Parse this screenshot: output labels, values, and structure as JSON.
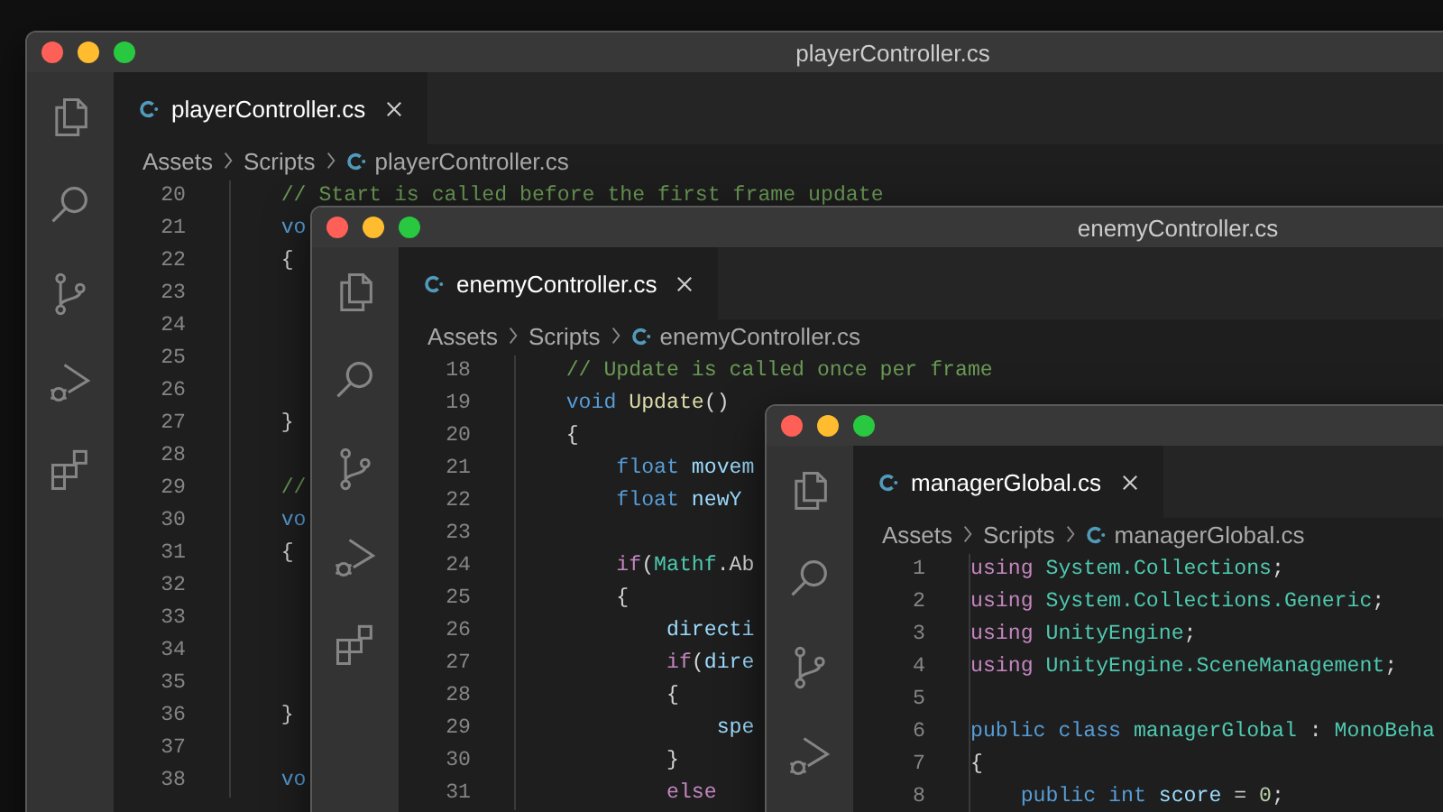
{
  "windows": [
    {
      "title": "playerController.cs",
      "tab": {
        "label": "playerController.cs",
        "selected": true
      },
      "breadcrumb": [
        "Assets",
        "Scripts",
        "playerController.cs"
      ],
      "lines": [
        {
          "number": "20",
          "segments": [
            {
              "kind": "comment",
              "text": "    // Start is called before the first frame update"
            }
          ]
        },
        {
          "number": "21",
          "segments": [
            {
              "kind": "keyword",
              "text": "    vo"
            }
          ]
        },
        {
          "number": "22",
          "segments": [
            {
              "kind": "plain",
              "text": "    {"
            }
          ]
        },
        {
          "number": "23"
        },
        {
          "number": "24"
        },
        {
          "number": "25"
        },
        {
          "number": "26"
        },
        {
          "number": "27",
          "segments": [
            {
              "kind": "plain",
              "text": "    }"
            }
          ]
        },
        {
          "number": "28"
        },
        {
          "number": "29",
          "segments": [
            {
              "kind": "comment",
              "text": "    //"
            }
          ]
        },
        {
          "number": "30",
          "segments": [
            {
              "kind": "keyword",
              "text": "    vo"
            }
          ]
        },
        {
          "number": "31",
          "segments": [
            {
              "kind": "plain",
              "text": "    {"
            }
          ]
        },
        {
          "number": "32"
        },
        {
          "number": "33"
        },
        {
          "number": "34"
        },
        {
          "number": "35"
        },
        {
          "number": "36",
          "segments": [
            {
              "kind": "plain",
              "text": "    }"
            }
          ]
        },
        {
          "number": "37"
        },
        {
          "number": "38",
          "segments": [
            {
              "kind": "keyword",
              "text": "    vo"
            }
          ]
        }
      ]
    },
    {
      "title": "enemyController.cs",
      "tab": {
        "label": "enemyController.cs",
        "selected": true
      },
      "breadcrumb": [
        "Assets",
        "Scripts",
        "enemyController.cs"
      ],
      "lines": [
        {
          "number": "18",
          "segments": [
            {
              "kind": "comment",
              "text": "    // Update is called once per frame"
            }
          ]
        },
        {
          "number": "19",
          "segments": [
            {
              "kind": "keyword",
              "text": "    void"
            },
            {
              "kind": "function",
              "text": " Update"
            },
            {
              "kind": "plain",
              "text": "()"
            }
          ]
        },
        {
          "number": "20",
          "segments": [
            {
              "kind": "plain",
              "text": "    {"
            }
          ]
        },
        {
          "number": "21",
          "segments": [
            {
              "kind": "keyword",
              "text": "        float"
            },
            {
              "kind": "variable",
              "text": " movem"
            }
          ]
        },
        {
          "number": "22",
          "segments": [
            {
              "kind": "keyword",
              "text": "        float"
            },
            {
              "kind": "variable",
              "text": " newY"
            }
          ]
        },
        {
          "number": "23"
        },
        {
          "number": "24",
          "segments": [
            {
              "kind": "control",
              "text": "        if"
            },
            {
              "kind": "plain",
              "text": "("
            },
            {
              "kind": "type",
              "text": "Mathf"
            },
            {
              "kind": "plain",
              "text": ".Ab"
            }
          ]
        },
        {
          "number": "25",
          "segments": [
            {
              "kind": "plain",
              "text": "        {"
            }
          ]
        },
        {
          "number": "26",
          "segments": [
            {
              "kind": "variable",
              "text": "            directi"
            }
          ]
        },
        {
          "number": "27",
          "segments": [
            {
              "kind": "control",
              "text": "            if"
            },
            {
              "kind": "plain",
              "text": "("
            },
            {
              "kind": "variable",
              "text": "dire"
            }
          ]
        },
        {
          "number": "28",
          "segments": [
            {
              "kind": "plain",
              "text": "            {"
            }
          ]
        },
        {
          "number": "29",
          "segments": [
            {
              "kind": "variable",
              "text": "                spe"
            }
          ]
        },
        {
          "number": "30",
          "segments": [
            {
              "kind": "plain",
              "text": "            }"
            }
          ]
        },
        {
          "number": "31",
          "segments": [
            {
              "kind": "control",
              "text": "            else"
            }
          ]
        }
      ]
    },
    {
      "tab": {
        "label": "managerGlobal.cs",
        "selected": true
      },
      "breadcrumb": [
        "Assets",
        "Scripts",
        "managerGlobal.cs"
      ],
      "lines": [
        {
          "number": "1",
          "segments": [
            {
              "kind": "control",
              "text": "using"
            },
            {
              "kind": "type",
              "text": " System.Collections"
            },
            {
              "kind": "plain",
              "text": ";"
            }
          ]
        },
        {
          "number": "2",
          "segments": [
            {
              "kind": "control",
              "text": "using"
            },
            {
              "kind": "type",
              "text": " System.Collections.Generic"
            },
            {
              "kind": "plain",
              "text": ";"
            }
          ]
        },
        {
          "number": "3",
          "segments": [
            {
              "kind": "control",
              "text": "using"
            },
            {
              "kind": "type",
              "text": " UnityEngine"
            },
            {
              "kind": "plain",
              "text": ";"
            }
          ]
        },
        {
          "number": "4",
          "segments": [
            {
              "kind": "control",
              "text": "using"
            },
            {
              "kind": "type",
              "text": " UnityEngine.SceneManagement"
            },
            {
              "kind": "plain",
              "text": ";"
            }
          ]
        },
        {
          "number": "5"
        },
        {
          "number": "6",
          "segments": [
            {
              "kind": "keyword",
              "text": "public class"
            },
            {
              "kind": "type",
              "text": " managerGlobal"
            },
            {
              "kind": "plain",
              "text": " : "
            },
            {
              "kind": "type",
              "text": "MonoBeha"
            }
          ]
        },
        {
          "number": "7",
          "segments": [
            {
              "kind": "plain",
              "text": "{"
            }
          ]
        },
        {
          "number": "8",
          "segments": [
            {
              "kind": "keyword",
              "text": "    public int"
            },
            {
              "kind": "variable",
              "text": " score"
            },
            {
              "kind": "plain",
              "text": " = "
            },
            {
              "kind": "number",
              "text": "0"
            },
            {
              "kind": "plain",
              "text": ";"
            }
          ]
        }
      ]
    }
  ]
}
